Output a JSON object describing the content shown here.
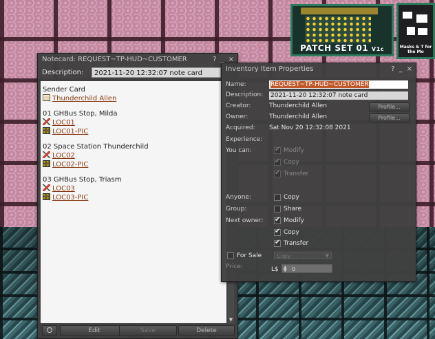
{
  "world": {
    "patchset_label": "PATCH SET 01",
    "patchset_sublabel": "V1c",
    "masks_label": "Masks & T for the Mo"
  },
  "notecard": {
    "title": "Notecard: REQUEST~TP-HUD~CUSTOMER",
    "controls": [
      "?",
      "_",
      "×"
    ],
    "description_label": "Description:",
    "description_value": "2021-11-20 12:32:07 note card",
    "sender_label": "Sender Card",
    "sender_link": "Thunderchild Allen",
    "entries": [
      {
        "heading": "01 GHBus Stop, Milda",
        "landmark": "LOC01",
        "texture": "LOC01-PIC"
      },
      {
        "heading": "02 Space Station Thunderchild",
        "landmark": "LOC02",
        "texture": "LOC02-PIC"
      },
      {
        "heading": "03 GHBus Stop, Triasm",
        "landmark": "LOC03",
        "texture": "LOC03-PIC"
      }
    ],
    "buttons": {
      "edit": "Edit",
      "save": "Save",
      "delete": "Delete"
    }
  },
  "properties": {
    "title": "Inventory Item Properties",
    "controls": [
      "?",
      "_",
      "×"
    ],
    "name_label": "Name:",
    "name_value": "REQUEST~TP-HUD~CUSTOMER",
    "description_label": "Description:",
    "description_value": "2021-11-20 12:32:07 note card",
    "creator_label": "Creator:",
    "creator_value": "Thunderchild Allen",
    "owner_label": "Owner:",
    "owner_value": "Thunderchild Allen",
    "profile_button": "Profile...",
    "acquired_label": "Acquired:",
    "acquired_value": "Sat Nov 20 12:32:08 2021",
    "experience_label": "Experience:",
    "you_can_label": "You can:",
    "you_can": [
      {
        "label": "Modify",
        "checked": true
      },
      {
        "label": "Copy",
        "checked": true
      },
      {
        "label": "Transfer",
        "checked": true
      }
    ],
    "anyone_label": "Anyone:",
    "anyone_copy": "Copy",
    "group_label": "Group:",
    "group_share": "Share",
    "next_owner_label": "Next owner:",
    "next_owner": [
      {
        "label": "Modify",
        "checked": true
      },
      {
        "label": "Copy",
        "checked": true
      },
      {
        "label": "Transfer",
        "checked": true
      }
    ],
    "for_sale_label": "For Sale",
    "sale_type": "Copy",
    "price_label": "Price:",
    "currency": "L$",
    "price_value": "0"
  }
}
